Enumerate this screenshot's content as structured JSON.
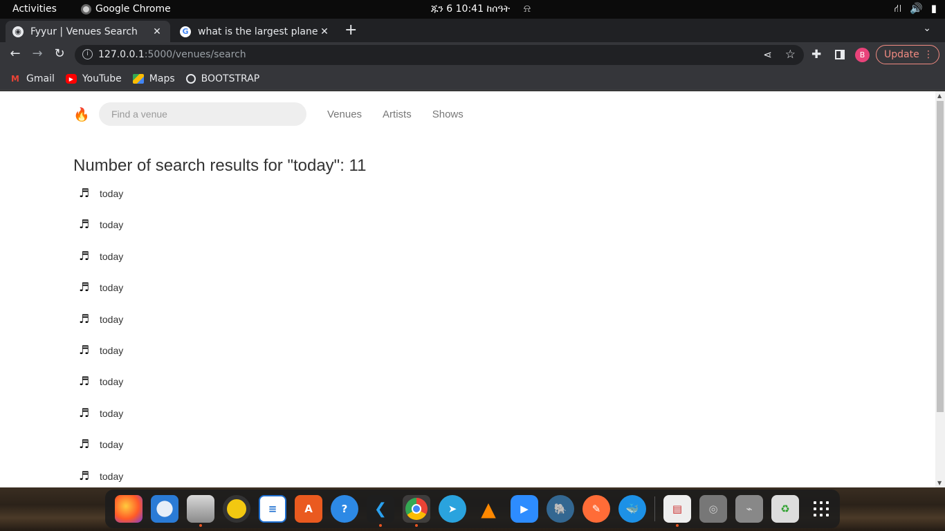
{
  "system_bar": {
    "activities": "Activities",
    "app_name": "Google Chrome",
    "clock": "ጁን 6  10:41 ከሰዓት"
  },
  "browser": {
    "tabs": [
      {
        "title": "Fyyur | Venues Search",
        "active": true
      },
      {
        "title": "what is the largest planet",
        "active": false
      }
    ],
    "url_host": "127.0.0.1",
    "url_rest": ":5000/venues/search",
    "profile_initial": "B",
    "update_label": "Update",
    "bookmarks": [
      {
        "label": "Gmail",
        "icon": "gmail-icon"
      },
      {
        "label": "YouTube",
        "icon": "youtube-icon"
      },
      {
        "label": "Maps",
        "icon": "maps-icon"
      },
      {
        "label": "BOOTSTRAP",
        "icon": "globe-icon"
      }
    ]
  },
  "page": {
    "logo": "🔥",
    "search_placeholder": "Find a venue",
    "nav": [
      "Venues",
      "Artists",
      "Shows"
    ],
    "heading": "Number of search results for \"today\": 11",
    "results": [
      "today",
      "today",
      "today",
      "today",
      "today",
      "today",
      "today",
      "today",
      "today",
      "today"
    ]
  },
  "dock": {
    "apps": [
      "firefox-icon",
      "thunderbird-icon",
      "files-icon",
      "rhythmbox-icon",
      "writer-icon",
      "software-icon",
      "help-icon",
      "vscode-icon",
      "chrome-icon",
      "telegram-icon",
      "vlc-icon",
      "zoom-icon",
      "postgresql-icon",
      "postman-icon",
      "docker-icon",
      "document-viewer-icon",
      "disk-icon",
      "usb-icon",
      "trash-icon",
      "show-apps-icon"
    ]
  }
}
